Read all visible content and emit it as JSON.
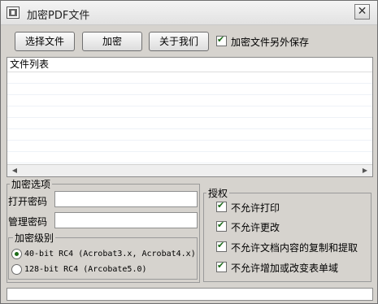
{
  "window": {
    "title": "加密PDF文件",
    "close_glyph": "✕",
    "app_icon": "pdf-app-icon"
  },
  "toolbar": {
    "select_file_label": "选择文件",
    "encrypt_label": "加密",
    "about_label": "关于我们",
    "save_separately_label": "加密文件另外保存",
    "save_separately_checked": true
  },
  "file_list": {
    "header": "文件列表",
    "items": [],
    "scroll_left_glyph": "◀",
    "scroll_right_glyph": "▶"
  },
  "encryption_options": {
    "title": "加密选项",
    "open_password_label": "打开密码",
    "open_password_value": "",
    "manage_password_label": "管理密码",
    "manage_password_value": "",
    "level_group_title": "加密级别",
    "levels": [
      {
        "label": "40-bit RC4 (Acrobat3.x, Acrobat4.x)",
        "selected": true
      },
      {
        "label": "128-bit RC4 (Arcobate5.0)",
        "selected": false
      }
    ]
  },
  "permissions": {
    "title": "授权",
    "items": [
      {
        "label": "不允许打印",
        "checked": true
      },
      {
        "label": "不允许更改",
        "checked": true
      },
      {
        "label": "不允许文档内容的复制和提取",
        "checked": true
      },
      {
        "label": "不允许增加或改变表单域",
        "checked": true
      }
    ]
  },
  "status_bar": {
    "text": ""
  },
  "colors": {
    "window_bg": "#d6d3ce",
    "check_color": "#1c6b18"
  }
}
